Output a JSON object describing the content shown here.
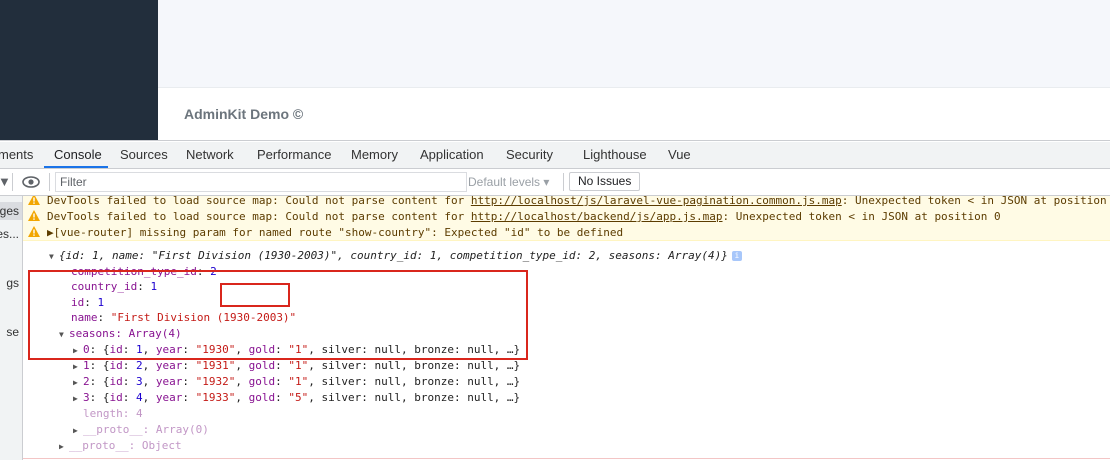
{
  "app": {
    "footer_brand": "AdminKit Demo ©"
  },
  "devtools": {
    "tabs": [
      "ments",
      "Console",
      "Sources",
      "Network",
      "Performance",
      "Memory",
      "Application",
      "Security",
      "Lighthouse",
      "Vue"
    ],
    "active_tab": "Console",
    "filter_placeholder": "Filter",
    "levels_label": "Default levels ▾",
    "no_issues_label": "No Issues",
    "left_panel": [
      "ges",
      "es...",
      "gs",
      "se"
    ],
    "icons": [
      "clear-console-icon",
      "eye-icon",
      "warning-icon",
      "expand-arrow-icon",
      "info-icon"
    ]
  },
  "console": {
    "warnings": [
      {
        "pre": "DevTools failed to load source map: Could not parse content for ",
        "link": "http://localhost/js/laravel-vue-pagination.common.js.map",
        "post": ": Unexpected token < in JSON at position"
      },
      {
        "pre": "DevTools failed to load source map: Could not parse content for ",
        "link": "http://localhost/backend/js/app.js.map",
        "post": ": Unexpected token < in JSON at position 0"
      },
      {
        "pre": "▶[vue-router] missing param for named route \"show-country\": Expected \"id\" to be defined",
        "link": "",
        "post": ""
      }
    ],
    "object_summary": "{id: 1, name: \"First Division (1930-2003)\", country_id: 1, competition_type_id: 2, seasons: Array(4)}",
    "props": [
      {
        "key": "competition_type_id",
        "value": "2"
      },
      {
        "key": "country_id",
        "value": "1"
      },
      {
        "key": "id",
        "value": "1"
      },
      {
        "key": "name",
        "value": "\"First Division (1930-2003)\""
      }
    ],
    "seasons_label": "seasons: Array(4)",
    "seasons": [
      {
        "idx": "0",
        "id": "1",
        "year": "\"1930\"",
        "gold": "\"1\""
      },
      {
        "idx": "1",
        "id": "2",
        "year": "\"1931\"",
        "gold": "\"1\""
      },
      {
        "idx": "2",
        "id": "3",
        "year": "\"1932\"",
        "gold": "\"1\""
      },
      {
        "idx": "3",
        "id": "4",
        "year": "\"1933\"",
        "gold": "\"5\""
      }
    ],
    "season_tail": "silver: null, bronze: null, …}",
    "length_label": "length: 4",
    "proto_array": "__proto__: Array(0)",
    "proto_object": "__proto__: Object"
  }
}
